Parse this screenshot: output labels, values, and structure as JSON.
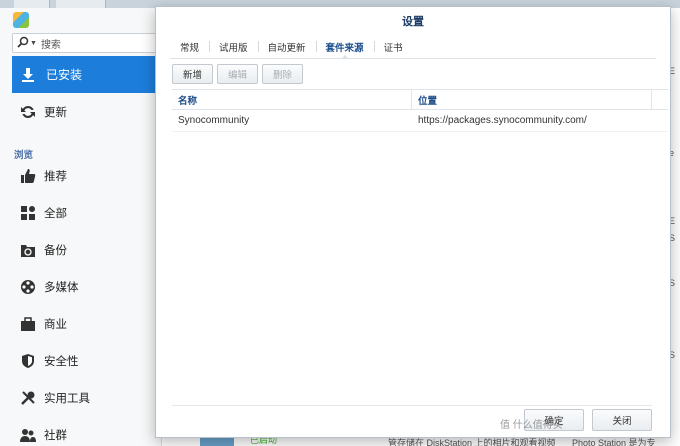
{
  "sidebar": {
    "search": {
      "placeholder": "搜索"
    },
    "active_item": {
      "label": "已安装",
      "icon": "download-icon"
    },
    "update_item": {
      "label": "更新",
      "icon": "refresh-icon"
    },
    "section_label": "浏览",
    "items": [
      {
        "label": "推荐",
        "icon": "thumbs-up-icon"
      },
      {
        "label": "全部",
        "icon": "grid-icon"
      },
      {
        "label": "备份",
        "icon": "backup-icon"
      },
      {
        "label": "多媒体",
        "icon": "film-reel-icon"
      },
      {
        "label": "商业",
        "icon": "briefcase-icon"
      },
      {
        "label": "安全性",
        "icon": "shield-icon"
      },
      {
        "label": "实用工具",
        "icon": "tools-icon"
      },
      {
        "label": "社群",
        "icon": "community-icon"
      }
    ]
  },
  "background": {
    "right_fragments": [
      "E",
      "e",
      "E",
      "S",
      "S",
      "S"
    ],
    "bottom_status": "已启动",
    "bottom_text_1": "管存储在 DiskStation 上的相片和观看视频",
    "bottom_text_2": "Photo Station 是为专业人"
  },
  "dialog": {
    "title": "设置",
    "tabs": [
      "常规",
      "试用版",
      "自动更新",
      "套件来源",
      "证书"
    ],
    "active_tab_index": 3,
    "toolbar": {
      "add": "新增",
      "edit": "编辑",
      "delete": "删除"
    },
    "columns": {
      "name": "名称",
      "location": "位置"
    },
    "rows": [
      {
        "name": "Synocommunity",
        "location": "https://packages.synocommunity.com/"
      }
    ],
    "ok_label": "确定",
    "close_label": "关闭"
  },
  "watermark": "值 什么值得买",
  "colors": {
    "accent": "#1d7ddb",
    "header_text": "#1f4d8a"
  }
}
